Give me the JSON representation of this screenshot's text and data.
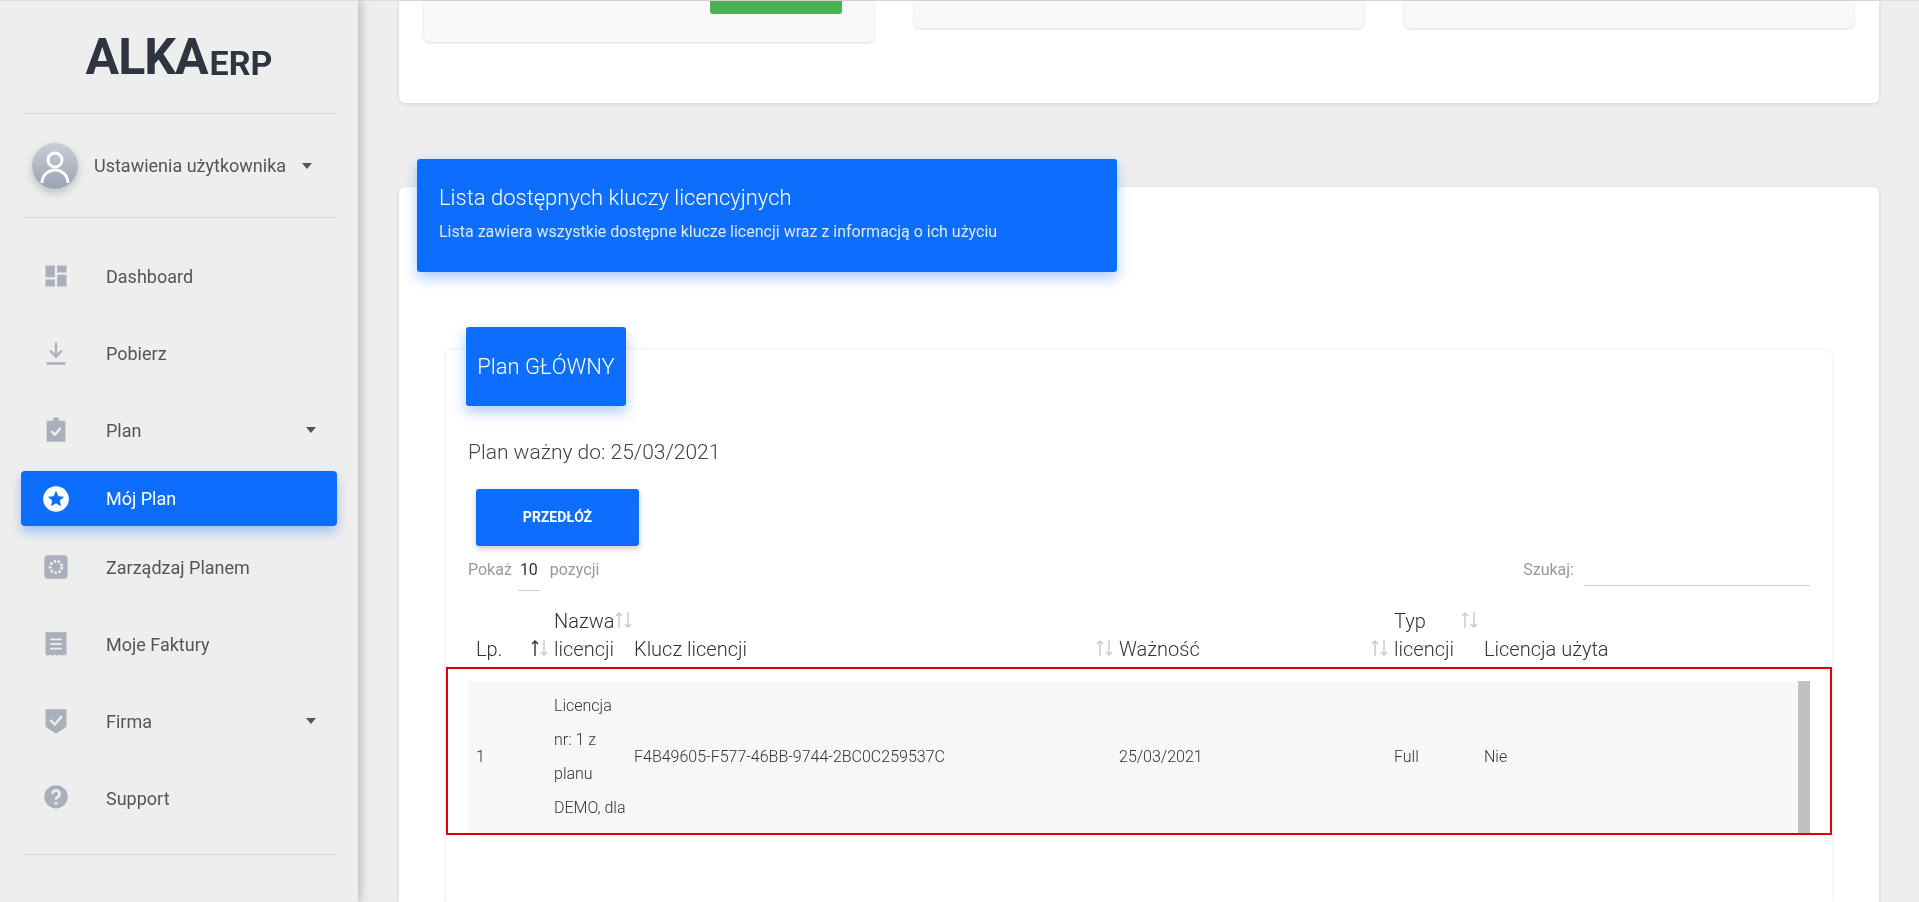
{
  "sidebar": {
    "logo": {
      "bold": "ALKA",
      "light": "ERP"
    },
    "user": {
      "label": "Ustawienia użytkownika",
      "has_menu": true
    },
    "items": [
      {
        "label": "Dashboard",
        "kind": "dashboard",
        "selected": false,
        "has_menu": false
      },
      {
        "label": "Pobierz",
        "kind": "download",
        "selected": false,
        "has_menu": false
      },
      {
        "label": "Plan",
        "kind": "clipboard",
        "selected": false,
        "has_menu": true
      },
      {
        "label": "Mój Plan",
        "kind": "star",
        "selected": true,
        "has_menu": false
      },
      {
        "label": "Zarządzaj Planem",
        "kind": "gear",
        "selected": false,
        "has_menu": false
      },
      {
        "label": "Moje Faktury",
        "kind": "receipt",
        "selected": false,
        "has_menu": false
      },
      {
        "label": "Firma",
        "kind": "shield",
        "selected": false,
        "has_menu": true
      },
      {
        "label": "Support",
        "kind": "help",
        "selected": false,
        "has_menu": false
      }
    ]
  },
  "header": {
    "title": "Lista dostępnych kluczy licencyjnych",
    "subtitle": "Lista zawiera wszystkie dostępne klucze licencji wraz z informacją o ich użyciu"
  },
  "plan": {
    "title": "Plan GŁÓWNY",
    "valid_until": "Plan ważny do: 25/03/2021",
    "button": "PRZEDŁÓŻ"
  },
  "table_controls": {
    "show_label": "Pokaż",
    "page_size": "10",
    "show_suffix": "pozycji",
    "search_label": "Szukaj:"
  },
  "table": {
    "columns": [
      {
        "label": "Lp.",
        "kind": "sorted"
      },
      {
        "label": "Nazwa licencji",
        "kind": "sortable"
      },
      {
        "label": "Klucz licencji",
        "kind": "sortable"
      },
      {
        "label": "Ważność",
        "kind": "sortable"
      },
      {
        "label": "Typ licencji",
        "kind": "sortable"
      },
      {
        "label": "Licencja użyta",
        "kind": "plain"
      }
    ],
    "rows": [
      {
        "cells": [
          "1",
          "Licencja nr: 1 z planu DEMO, dla",
          "F4B49605-F577-46BB-9744-2BC0C259537C",
          "25/03/2021",
          "Full",
          "Nie"
        ],
        "highlighted": true
      }
    ]
  }
}
